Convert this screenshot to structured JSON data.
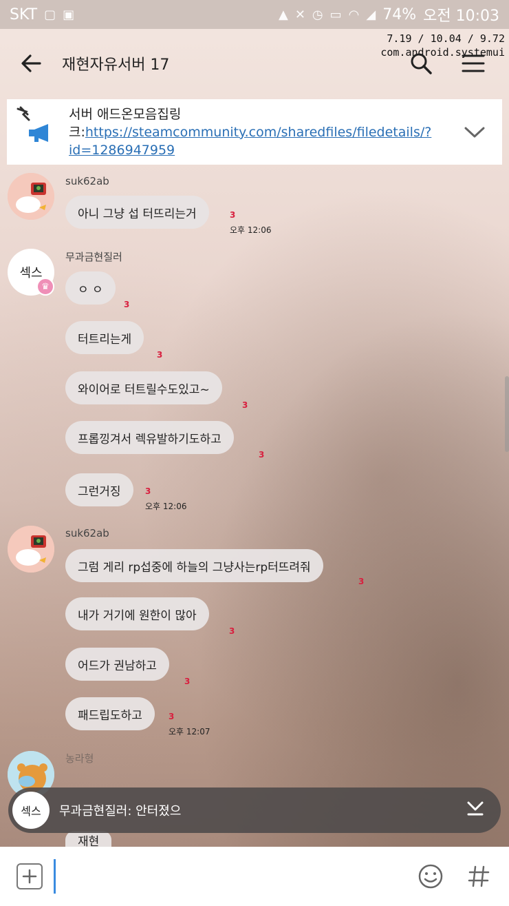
{
  "status": {
    "carrier": "SKT",
    "battery": "74%",
    "time": "오전 10:03"
  },
  "debug": {
    "line1": "7.19 / 10.04 / 9.72",
    "line2": "com.android.systemui"
  },
  "header": {
    "title": "재현자유서버 17"
  },
  "notice": {
    "text": "서버 애드온모음집링크:",
    "link": "https://steamcommunity.com/sharedfiles/filedetails/?id=1286947959"
  },
  "messages": {
    "m1_sender": "suk62ab",
    "m1_b1": "아니 그냥 섭 터뜨리는거",
    "m1_b1_unread": "3",
    "m1_b1_time": "오후 12:06",
    "m2_sender": "무과금현질러",
    "m2_avatar": "섹스",
    "m2_b1": "ㅇ ㅇ",
    "m2_b1_unread": "3",
    "m2_b2": "터트리는게",
    "m2_b2_unread": "3",
    "m2_b3": "와이어로 터트릴수도있고~",
    "m2_b3_unread": "3",
    "m2_b4": "프롭낑겨서 렉유발하기도하고",
    "m2_b4_unread": "3",
    "m2_b5": "그런거징",
    "m2_b5_unread": "3",
    "m2_b5_time": "오후 12:06",
    "m3_sender": "suk62ab",
    "m3_b1": "그럼 게리 rp섭중에 하늘의 그냥사는rp터뜨려줘",
    "m3_b1_unread": "3",
    "m3_b2": "내가 거기에 원한이 많아",
    "m3_b2_unread": "3",
    "m3_b3": "어드가 권남하고",
    "m3_b3_unread": "3",
    "m3_b4": "패드립도하고",
    "m3_b4_unread": "3",
    "m3_b4_time": "오후 12:07",
    "m4_sender": "농라형",
    "m4_partial": "재현"
  },
  "popup": {
    "avatar": "섹스",
    "text": "무과금현질러: 안터졌으"
  },
  "icons": {
    "back": "back-arrow-icon",
    "search": "search-icon",
    "menu": "menu-icon",
    "notice": "megaphone-icon",
    "chevron": "chevron-down-icon",
    "plus": "plus-icon",
    "emoji": "emoji-icon",
    "hash": "hash-icon"
  }
}
